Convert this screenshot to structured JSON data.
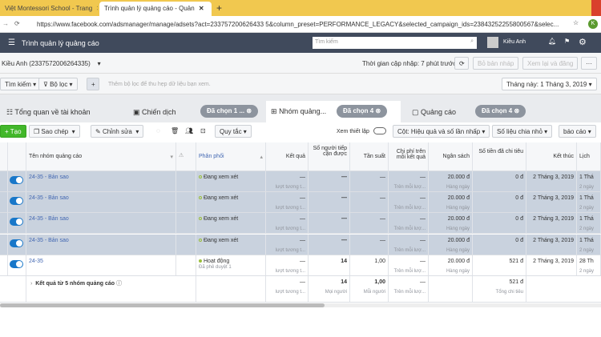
{
  "browser": {
    "tab1": "Việt Montessori School - Trang",
    "tab2": "Trình quản lý quảng cáo - Quản",
    "url": "https://www.facebook.com/adsmanager/manage/adsets?act=233757200626433 5&column_preset=PERFORMANCE_LEGACY&selected_campaign_ids=23843252255800567&selec...",
    "profile": "K"
  },
  "nav": {
    "title": "Trình quản lý quảng cáo",
    "search_placeholder": "Tìm kiếm",
    "user": "Kiều Anh"
  },
  "account": {
    "name": "Kiều Anh (2337572006264335)",
    "updated": "Thời gian cập nhập: 7 phút trước",
    "discard": "Bỏ bản nháp",
    "review": "Xem lại và đăng",
    "more": "···"
  },
  "filter": {
    "search": "Tìm kiếm ▾",
    "filter": "Bộ lọc ▾",
    "hint": "Thêm bộ lọc để thu hẹp dữ liệu bạn xem.",
    "date": "Tháng này: 1 Tháng 3, 2019 ▾"
  },
  "levels": {
    "overview": "Tổng quan về tài khoản",
    "campaigns": "Chiến dịch",
    "campaigns_sel": "Đã chọn 1 ...",
    "adsets": "Nhóm quảng...",
    "adsets_sel": "Đã chọn 4",
    "ads": "Quảng cáo",
    "ads_sel": "Đã chọn 4"
  },
  "toolbar": {
    "create": "+ Tạo",
    "copy": "Sao chép",
    "edit": "Chỉnh sửa",
    "rules": "Quy tắc ▾",
    "view_setup": "Xem thiết lập",
    "columns": "Cột: Hiệu quả và số lần nhấp ▾",
    "breakdown": "Số liệu chia nhỏ ▾",
    "reports": "báo cáo ▾"
  },
  "columns": [
    "Tên nhóm quảng cáo",
    "Phân phối",
    "Kết quả",
    "Số người tiếp cận được",
    "Tần suất",
    "Chi phí trên mỗi kết quả",
    "Ngân sách",
    "Số tiền đã chi tiêu",
    "Kết thúc",
    "Lịch"
  ],
  "rows": [
    {
      "name": "24-35 - Bản sao",
      "status": "Đang xem xét",
      "status_sub": "",
      "result": "—",
      "result_sub": "lượt tương t...",
      "reach": "—",
      "freq": "—",
      "cpr": "—",
      "cpr_sub": "Trên mỗi lượ...",
      "budget": "20.000 đ",
      "budget_sub": "Hàng ngày",
      "spent": "0 đ",
      "end": "2 Tháng 3, 2019",
      "sched": "1 Thá",
      "sched_sub": "2 ngày",
      "selected": true
    },
    {
      "name": "24-35 - Bản sao",
      "status": "Đang xem xét",
      "status_sub": "",
      "result": "—",
      "result_sub": "lượt tương t...",
      "reach": "—",
      "freq": "—",
      "cpr": "—",
      "cpr_sub": "Trên mỗi lượ...",
      "budget": "20.000 đ",
      "budget_sub": "Hàng ngày",
      "spent": "0 đ",
      "end": "2 Tháng 3, 2019",
      "sched": "1 Thá",
      "sched_sub": "2 ngày",
      "selected": true
    },
    {
      "name": "24-35 - Bản sao",
      "status": "Đang xem xét",
      "status_sub": "",
      "result": "—",
      "result_sub": "lượt tương t...",
      "reach": "—",
      "freq": "—",
      "cpr": "—",
      "cpr_sub": "Trên mỗi lượ...",
      "budget": "20.000 đ",
      "budget_sub": "Hàng ngày",
      "spent": "0 đ",
      "end": "2 Tháng 3, 2019",
      "sched": "1 Thá",
      "sched_sub": "2 ngày",
      "selected": true
    },
    {
      "name": "24-35 - Bản sao",
      "status": "Đang xem xét",
      "status_sub": "",
      "result": "—",
      "result_sub": "lượt tương t...",
      "reach": "—",
      "freq": "—",
      "cpr": "—",
      "cpr_sub": "Trên mỗi lượ...",
      "budget": "20.000 đ",
      "budget_sub": "Hàng ngày",
      "spent": "0 đ",
      "end": "2 Tháng 3, 2019",
      "sched": "1 Thá",
      "sched_sub": "2 ngày",
      "selected": true
    },
    {
      "name": "24-35",
      "status": "Hoạt động",
      "status_sub": "Đã phê duyệt 1",
      "result": "—",
      "result_sub": "lượt tương t...",
      "reach": "14",
      "freq": "1,00",
      "cpr": "—",
      "cpr_sub": "Trên mỗi lượ...",
      "budget": "20.000 đ",
      "budget_sub": "Hàng ngày",
      "spent": "521 đ",
      "end": "2 Tháng 3, 2019",
      "sched": "28 Th",
      "sched_sub": "2 ngày",
      "selected": false
    }
  ],
  "total": {
    "label": "Kết quả từ 5 nhóm quảng cáo",
    "result": "—",
    "result_sub": "lượt tương t...",
    "reach": "14",
    "reach_sub": "Mọi người",
    "freq": "1,00",
    "freq_sub": "Mỗi người",
    "cpr": "—",
    "cpr_sub": "Trên mỗi lượ...",
    "spent": "521 đ",
    "spent_sub": "Tổng chi tiêu"
  },
  "colors": {
    "nav": "#404a5c",
    "selected_row": "#c9d2de",
    "toggle": "#1877c9",
    "create": "#42b72a"
  }
}
